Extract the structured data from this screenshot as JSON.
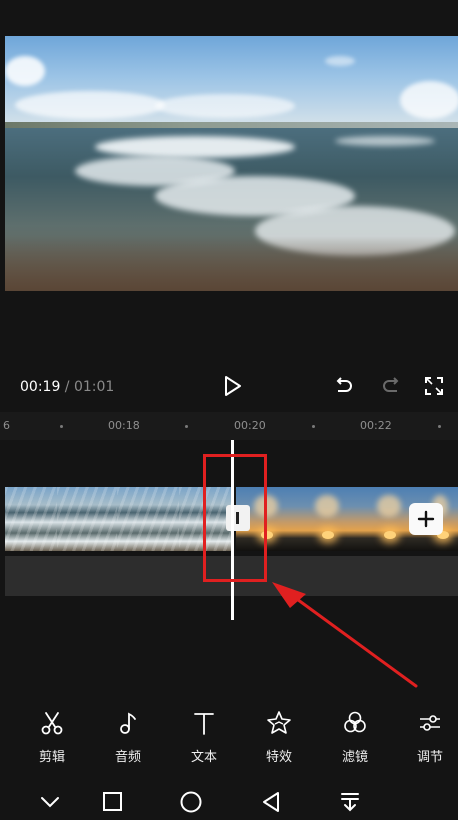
{
  "player": {
    "current_time": "00:19",
    "separator": " / ",
    "total_time": "01:01"
  },
  "ruler": {
    "labels": [
      "6",
      "00:18",
      "00:20",
      "00:22"
    ]
  },
  "toolbar": {
    "items": [
      {
        "label": "剪辑",
        "icon": "scissors-icon"
      },
      {
        "label": "音频",
        "icon": "music-note-icon"
      },
      {
        "label": "文本",
        "icon": "text-icon"
      },
      {
        "label": "特效",
        "icon": "effects-star-icon"
      },
      {
        "label": "滤镜",
        "icon": "filter-circles-icon"
      },
      {
        "label": "调节",
        "icon": "adjust-sliders-icon"
      }
    ]
  },
  "colors": {
    "background": "#141414",
    "highlight": "#e02020",
    "audio_lane": "#2d2d2d"
  }
}
